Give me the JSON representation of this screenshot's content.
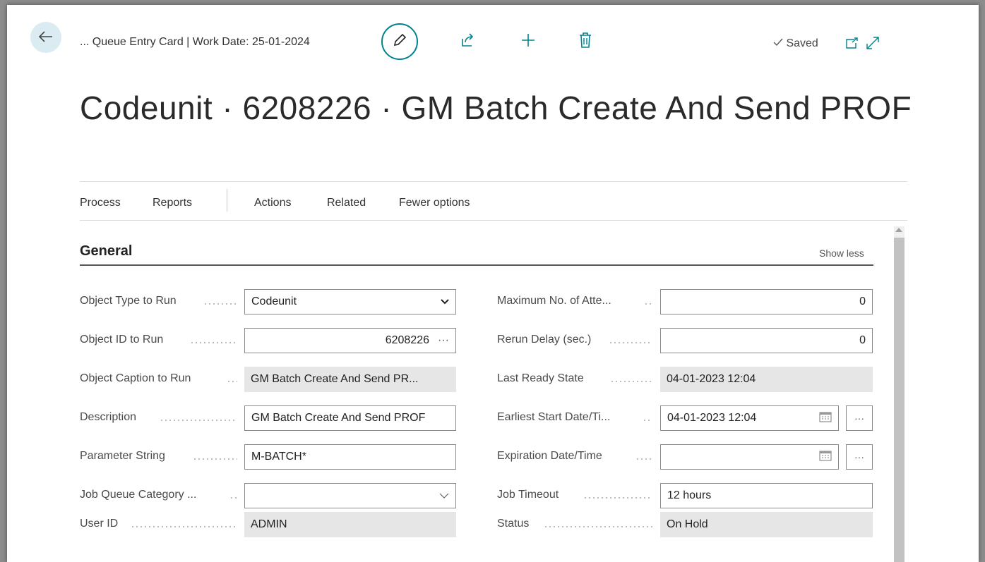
{
  "header": {
    "breadcrumb": "... Queue Entry Card | Work Date: 25-01-2024",
    "saved_label": "Saved",
    "title": "Codeunit · 6208226 · GM Batch Create And Send PROF"
  },
  "menu": {
    "items": [
      "Process",
      "Reports",
      "Actions",
      "Related",
      "Fewer options"
    ]
  },
  "section": {
    "title": "General",
    "toggle_label": "Show less"
  },
  "left_fields": [
    {
      "label": "Object Type to Run",
      "value": "Codeunit"
    },
    {
      "label": "Object ID to Run",
      "value": "6208226"
    },
    {
      "label": "Object Caption to Run",
      "value": "GM Batch Create And Send PR..."
    },
    {
      "label": "Description",
      "value": "GM Batch Create And Send PROF"
    },
    {
      "label": "Parameter String",
      "value": "M-BATCH*"
    },
    {
      "label": "Job Queue Category ...",
      "value": ""
    },
    {
      "label": "User ID",
      "value": "ADMIN"
    }
  ],
  "right_fields": [
    {
      "label": "Maximum No. of Atte...",
      "value": "0"
    },
    {
      "label": "Rerun Delay (sec.)",
      "value": "0"
    },
    {
      "label": "Last Ready State",
      "value": "04-01-2023 12:04"
    },
    {
      "label": "Earliest Start Date/Ti...",
      "value": "04-01-2023 12:04"
    },
    {
      "label": "Expiration Date/Time",
      "value": ""
    },
    {
      "label": "Job Timeout",
      "value": "12 hours"
    },
    {
      "label": "Status",
      "value": "On Hold"
    }
  ],
  "icons": {
    "back": "arrow-left-icon",
    "edit": "pencil-icon",
    "share": "share-icon",
    "new": "plus-icon",
    "delete": "trash-icon",
    "saved": "checkmark-icon",
    "open_new_window": "open-in-new-window-icon",
    "expand": "expand-icon",
    "dropdown": "chevron-down-icon",
    "calendar": "calendar-icon",
    "ellipsis": "ellipsis-icon"
  },
  "colors": {
    "accent": "#00838f",
    "back_button_bg": "#daecf2",
    "readonly_bg": "#e6e6e6"
  }
}
